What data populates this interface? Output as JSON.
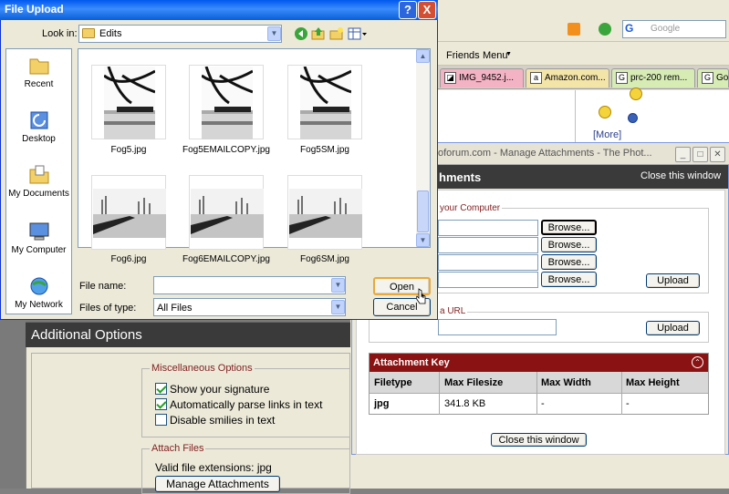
{
  "browser": {
    "friends": "Friends",
    "menu": "Menu",
    "search_placeholder": "Google",
    "tabs": [
      "IMG_9452.j...",
      "Amazon.com...",
      "prc-200 rem...",
      "Go"
    ],
    "more_link": "[More]"
  },
  "file_upload": {
    "title": "File Upload",
    "help": "?",
    "close": "X",
    "look_in_label": "Look in:",
    "look_in_value": "Edits",
    "places": [
      "Recent",
      "Desktop",
      "My Documents",
      "My Computer",
      "My Network"
    ],
    "files": [
      {
        "name": "Fog5.jpg"
      },
      {
        "name": "Fog5EMAILCOPY.jpg"
      },
      {
        "name": "Fog5SM.jpg"
      },
      {
        "name": "Fog6.jpg"
      },
      {
        "name": "Fog6EMAILCOPY.jpg"
      },
      {
        "name": "Fog6SM.jpg"
      }
    ],
    "file_name_label": "File name:",
    "file_name_value": "",
    "files_of_type_label": "Files of type:",
    "files_of_type_value": "All Files",
    "open_label": "Open",
    "cancel_label": "Cancel"
  },
  "additional_options": {
    "header": "Additional Options",
    "misc_legend": "Miscellaneous Options",
    "options": [
      {
        "label": "Show your signature",
        "checked": true
      },
      {
        "label": "Automatically parse links in text",
        "checked": true
      },
      {
        "label": "Disable smilies in text",
        "checked": false
      }
    ],
    "attach_legend": "Attach Files",
    "valid_ext": "Valid file extensions: jpg",
    "manage_btn": "Manage Attachments"
  },
  "manage_attachments": {
    "window_title": "oforum.com - Manage Attachments - The Phot...",
    "header": "hments",
    "close_top": "Close this window",
    "computer_legend": "your Computer",
    "browse_label": "Browse...",
    "upload_label": "Upload",
    "url_legend": "a URL",
    "url_value": "",
    "key_header": "Attachment Key",
    "key_columns": [
      "Filetype",
      "Max Filesize",
      "Max Width",
      "Max Height"
    ],
    "key_rows": [
      [
        "jpg",
        "341.8 KB",
        "-",
        "-"
      ]
    ],
    "close_bottom": "Close this window"
  }
}
